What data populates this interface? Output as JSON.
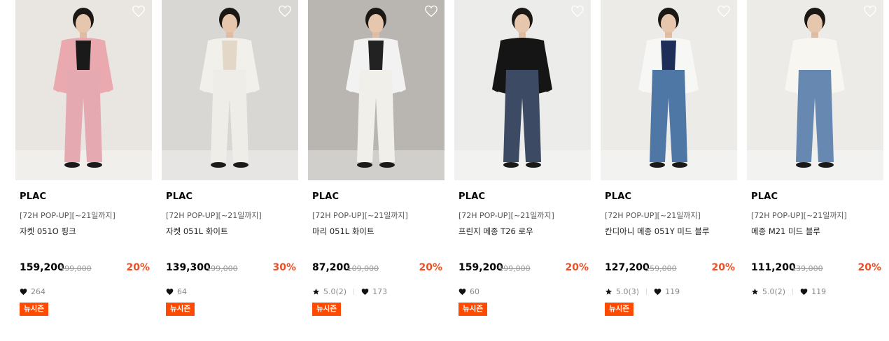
{
  "products": [
    {
      "brand": "PLAC",
      "promo": "[72H POP-UP][~21일까지]",
      "name": "자켓 051O 핑크",
      "price": "159,200",
      "original_price": "199,000",
      "discount": "20%",
      "rating": "",
      "likes": "264",
      "badge": "뉴시즌",
      "photo": {
        "bg": "#e9e6e2",
        "top": "#e9a9ae",
        "bottom": "#e5aab1",
        "inner": "#1a1a1a"
      }
    },
    {
      "brand": "PLAC",
      "promo": "[72H POP-UP][~21일까지]",
      "name": "자켓 051L 화이트",
      "price": "139,300",
      "original_price": "199,000",
      "discount": "30%",
      "rating": "",
      "likes": "64",
      "badge": "뉴시즌",
      "photo": {
        "bg": "#d9d7d4",
        "top": "#f2f0ea",
        "bottom": "#efede7",
        "inner": "#e3d8c7"
      }
    },
    {
      "brand": "PLAC",
      "promo": "[72H POP-UP][~21일까지]",
      "name": "마리 051L 화이트",
      "price": "87,200",
      "original_price": "109,000",
      "discount": "20%",
      "rating": "5.0(2)",
      "likes": "173",
      "badge": "뉴시즌",
      "photo": {
        "bg": "#b9b5b0",
        "top": "#f2f2f2",
        "bottom": "#f1efe9",
        "inner": "#222222"
      }
    },
    {
      "brand": "PLAC",
      "promo": "[72H POP-UP][~21일까지]",
      "name": "프린지 메종 T26 로우",
      "price": "159,200",
      "original_price": "199,000",
      "discount": "20%",
      "rating": "",
      "likes": "60",
      "badge": "뉴시즌",
      "photo": {
        "bg": "#ececea",
        "top": "#151515",
        "bottom": "#3c4a63",
        "inner": "#151515"
      }
    },
    {
      "brand": "PLAC",
      "promo": "[72H POP-UP][~21일까지]",
      "name": "칸디아니 메종 051Y 미드 블루",
      "price": "127,200",
      "original_price": "159,000",
      "discount": "20%",
      "rating": "5.0(3)",
      "likes": "119",
      "badge": "뉴시즌",
      "photo": {
        "bg": "#ecebe8",
        "top": "#f7f7f5",
        "bottom": "#4f77a6",
        "inner": "#1f2d59"
      }
    },
    {
      "brand": "PLAC",
      "promo": "[72H POP-UP][~21일까지]",
      "name": "메종 M21 미드 블루",
      "price": "111,200",
      "original_price": "139,000",
      "discount": "20%",
      "rating": "5.0(2)",
      "likes": "119",
      "badge": "",
      "photo": {
        "bg": "#ecebe8",
        "top": "#f7f6f1",
        "bottom": "#6688b1",
        "inner": "#f7f6f1"
      }
    }
  ],
  "colors": {
    "discount": "#f04f23",
    "badge_bg": "#ff4a00",
    "strike": "#999999"
  },
  "icons": {
    "wishlist": "heart-outline-icon",
    "likes": "heart-icon",
    "rating": "star-icon"
  }
}
